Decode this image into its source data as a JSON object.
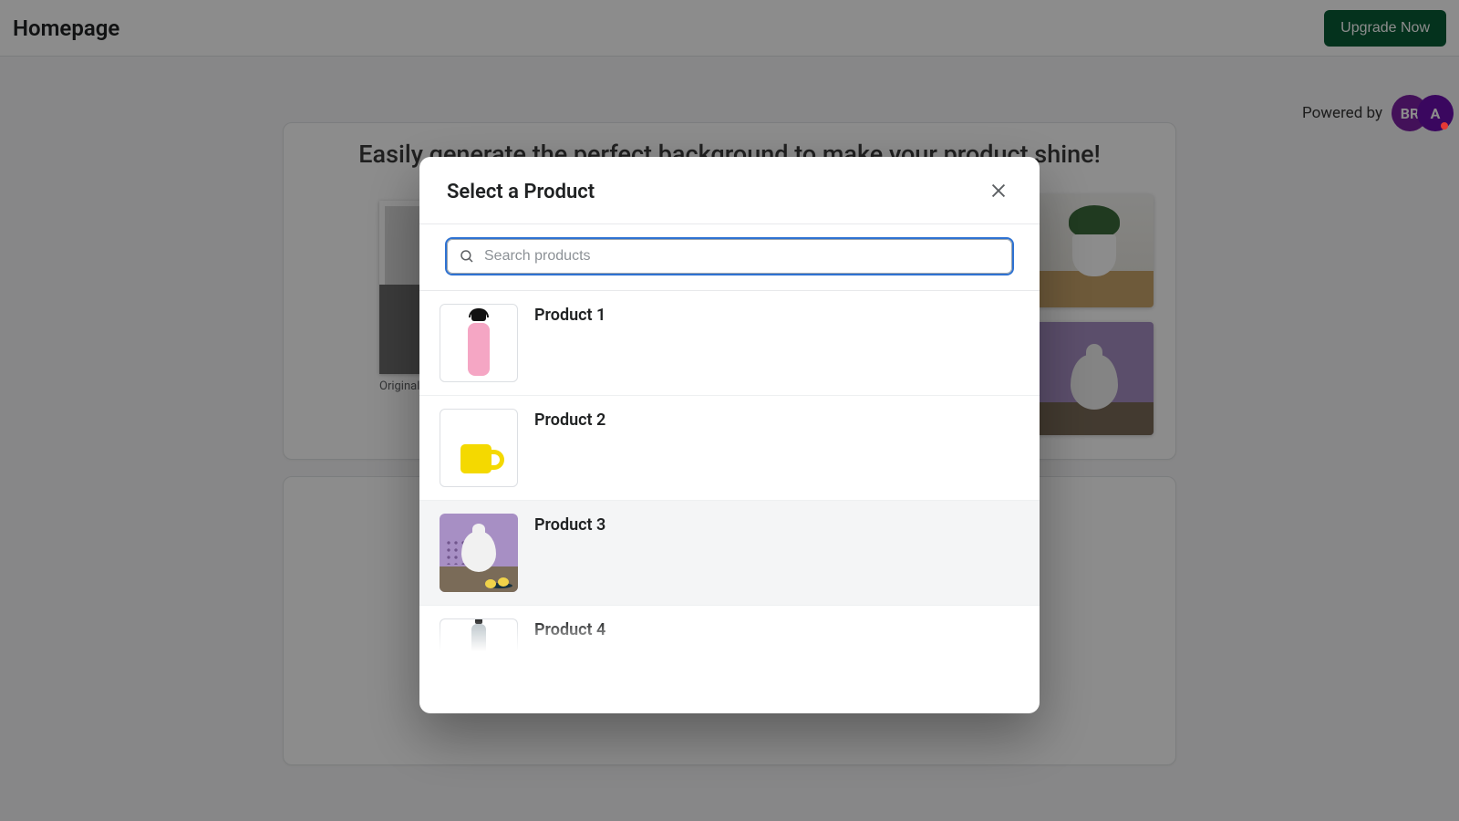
{
  "topbar": {
    "title": "Homepage",
    "upgrade_label": "Upgrade Now"
  },
  "powered_by": {
    "label": "Powered by",
    "brand_left": "BR",
    "brand_right": "A"
  },
  "hero": {
    "headline": "Easily generate the perfect background to make your product shine!",
    "original_label": "Original"
  },
  "modal": {
    "title": "Select a Product",
    "search_placeholder": "Search products",
    "products": [
      {
        "name": "Product 1",
        "thumb_kind": "bottle"
      },
      {
        "name": "Product 2",
        "thumb_kind": "mug"
      },
      {
        "name": "Product 3",
        "thumb_kind": "scene"
      },
      {
        "name": "Product 4",
        "thumb_kind": "p4"
      }
    ]
  }
}
